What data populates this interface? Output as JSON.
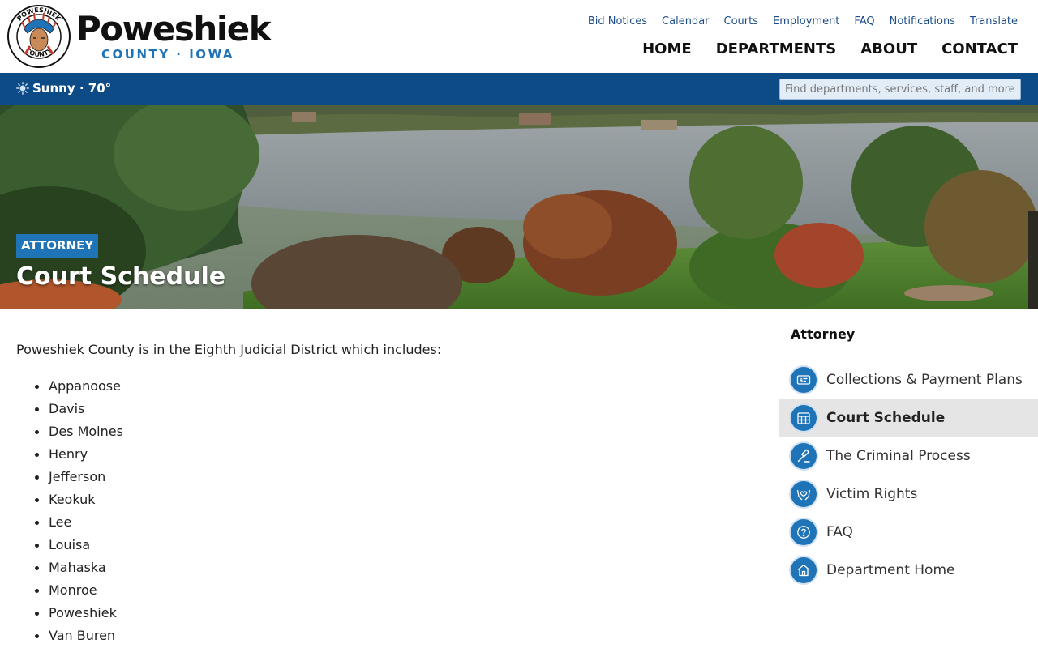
{
  "header": {
    "seal_text": "POWESHIEK COUNTY",
    "brand_name": "Poweshiek",
    "brand_sub": "COUNTY · IOWA",
    "util_nav": [
      "Bid Notices",
      "Calendar",
      "Courts",
      "Employment",
      "FAQ",
      "Notifications",
      "Translate"
    ],
    "main_nav": [
      "HOME",
      "DEPARTMENTS",
      "ABOUT",
      "CONTACT"
    ]
  },
  "bar": {
    "weather": "Sunny · 70°",
    "weather_icon": "sun-icon",
    "search_placeholder": "Find departments, services, staff, and more..."
  },
  "hero": {
    "badge": "ATTORNEY",
    "title": "Court Schedule"
  },
  "content": {
    "intro": "Poweshiek County is in the Eighth Judicial District which includes:",
    "counties": [
      "Appanoose",
      "Davis",
      "Des Moines",
      "Henry",
      "Jefferson",
      "Keokuk",
      "Lee",
      "Louisa",
      "Mahaska",
      "Monroe",
      "Poweshiek",
      "Van Buren"
    ]
  },
  "sidebar": {
    "title": "Attorney",
    "items": [
      {
        "label": "Collections & Payment Plans",
        "icon": "payment-icon",
        "active": false
      },
      {
        "label": "Court Schedule",
        "icon": "calendar-icon",
        "active": true
      },
      {
        "label": "The Criminal Process",
        "icon": "gavel-icon",
        "active": false
      },
      {
        "label": "Victim Rights",
        "icon": "hands-heart-icon",
        "active": false
      },
      {
        "label": "FAQ",
        "icon": "question-icon",
        "active": false
      },
      {
        "label": "Department Home",
        "icon": "home-icon",
        "active": false
      }
    ]
  },
  "colors": {
    "primary_blue": "#1f73b7",
    "bar_blue": "#0d4b87",
    "active_bg": "#e5e5e5"
  }
}
